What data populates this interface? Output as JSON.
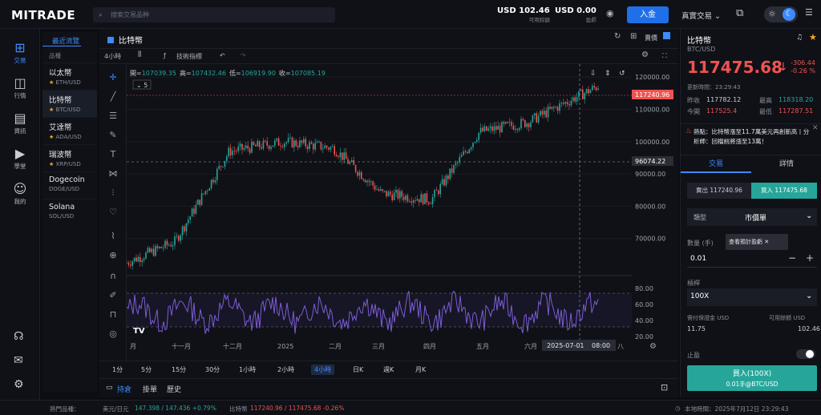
{
  "header": {
    "logo": "MITRADE",
    "search_placeholder": "搜索交易品种",
    "usd_balance": "USD 102.46",
    "usd_balance_label": "可用餘額",
    "usd_pnl": "USD 0.00",
    "usd_pnl_label": "盈虧",
    "deposit": "入金",
    "trade_mode": "真實交易"
  },
  "nav": [
    {
      "label": "交易",
      "icon": "add-square-icon"
    },
    {
      "label": "行情",
      "icon": "chart-icon"
    },
    {
      "label": "資訊",
      "icon": "document-icon"
    },
    {
      "label": "學堂",
      "icon": "play-icon"
    },
    {
      "label": "我的",
      "icon": "user-icon"
    }
  ],
  "products": {
    "tab": "最近流覽",
    "col": "品種",
    "items": [
      {
        "name": "以太幣",
        "sym": "ETH/USD",
        "star": true
      },
      {
        "name": "比特幣",
        "sym": "BTC/USD",
        "star": true
      },
      {
        "name": "艾達幣",
        "sym": "ADA/USD",
        "star": true
      },
      {
        "name": "瑞波幣",
        "sym": "XRP/USD",
        "star": true
      },
      {
        "name": "Dogecoin",
        "sym": "DOGE/USD",
        "star": false
      },
      {
        "name": "Solana",
        "sym": "SOL/USD",
        "star": false
      }
    ]
  },
  "chart": {
    "title": "比特幣",
    "interval": "4小時",
    "indicator": "技術指標",
    "view_label": "賣價",
    "ohlc": {
      "open_label": "開=",
      "open": "107039.35",
      "high_label": "高=",
      "high": "107432.46",
      "low_label": "低=",
      "low": "106919.90",
      "close_label": "收=",
      "close": "107085.19"
    },
    "legend_count": "5",
    "price_tag": "117240.96",
    "cross_tag": "96074.22",
    "date_tag": "2025-07-01",
    "time_tag": "08:00",
    "y_ticks": [
      "120000.00",
      "110000.00",
      "100000.00",
      "90000.00",
      "80000.00",
      "70000.00"
    ],
    "rsi_ticks": [
      "80.00",
      "60.00",
      "40.00",
      "20.00"
    ],
    "x_ticks": [
      "月",
      "十一月",
      "十二月",
      "2025",
      "二月",
      "三月",
      "四月",
      "五月",
      "六月",
      "八"
    ]
  },
  "chart_data": {
    "type": "line",
    "title": "",
    "xlabel": "",
    "ylabel": "",
    "ylim": [
      62000,
      124000
    ],
    "x": [
      "十月",
      "十一月",
      "十二月",
      "2025",
      "二月",
      "三月",
      "四月",
      "五月",
      "六月",
      "七月"
    ],
    "series": [
      {
        "values": [
          62500,
          69000,
          97000,
          100000,
          98000,
          84000,
          82000,
          103000,
          106000,
          117240.96
        ]
      }
    ]
  },
  "timeframes": [
    "1分",
    "5分",
    "15分",
    "30分",
    "1小時",
    "2小時",
    "4小時",
    "日K",
    "週K",
    "月K"
  ],
  "active_tf": "4小時",
  "bottom_tabs": [
    "持倉",
    "掛單",
    "歷史"
  ],
  "right": {
    "title": "比特幣",
    "sym": "BTC/USD",
    "price": "117475.68",
    "change": "-306.44",
    "pct": "-0.26 %",
    "updated": "更新時間：23:29:43",
    "rows": [
      [
        "昨收",
        "117782.12",
        "最高",
        "118318.20"
      ],
      [
        "今開",
        "117525.4",
        "最低",
        "117287.51"
      ]
    ],
    "news": "熱點：比特幣漲至11.7萬美元再創新高丨分析師：回檔前將漲至13萬！",
    "tab_trade": "交易",
    "tab_detail": "詳情",
    "sell": "賣出 117240.96",
    "buy": "買入 117475.68",
    "type_label": "類型",
    "type_val": "市價單",
    "qty_label": "數量 (手)",
    "qty": "0.01",
    "tooltip": "查看預計盈虧",
    "lev_label": "槓桿",
    "lev": "100X",
    "margin_label": "需付保證金 USD",
    "margin": "11.75",
    "avail_label": "可用餘額 USD",
    "avail": "102.46",
    "sl_label": "止盈",
    "buy_btn": "買入(100X)",
    "buy_sub": "0.01手@BTC/USD"
  },
  "footer": {
    "hot": "熱門品種：",
    "p1": "美元/日元",
    "p1v": "147.398 / 147.436 +0.79%",
    "p2": "比特幣",
    "p2v": "117240.96 / 117475.68 -0.26%",
    "time": "本地時間：2025年7月12日 23:29:43"
  },
  "colors": {
    "up": "#26a69a",
    "down": "#ef5350",
    "rsi": "#7c5cd6",
    "accent": "#3d8bff"
  }
}
